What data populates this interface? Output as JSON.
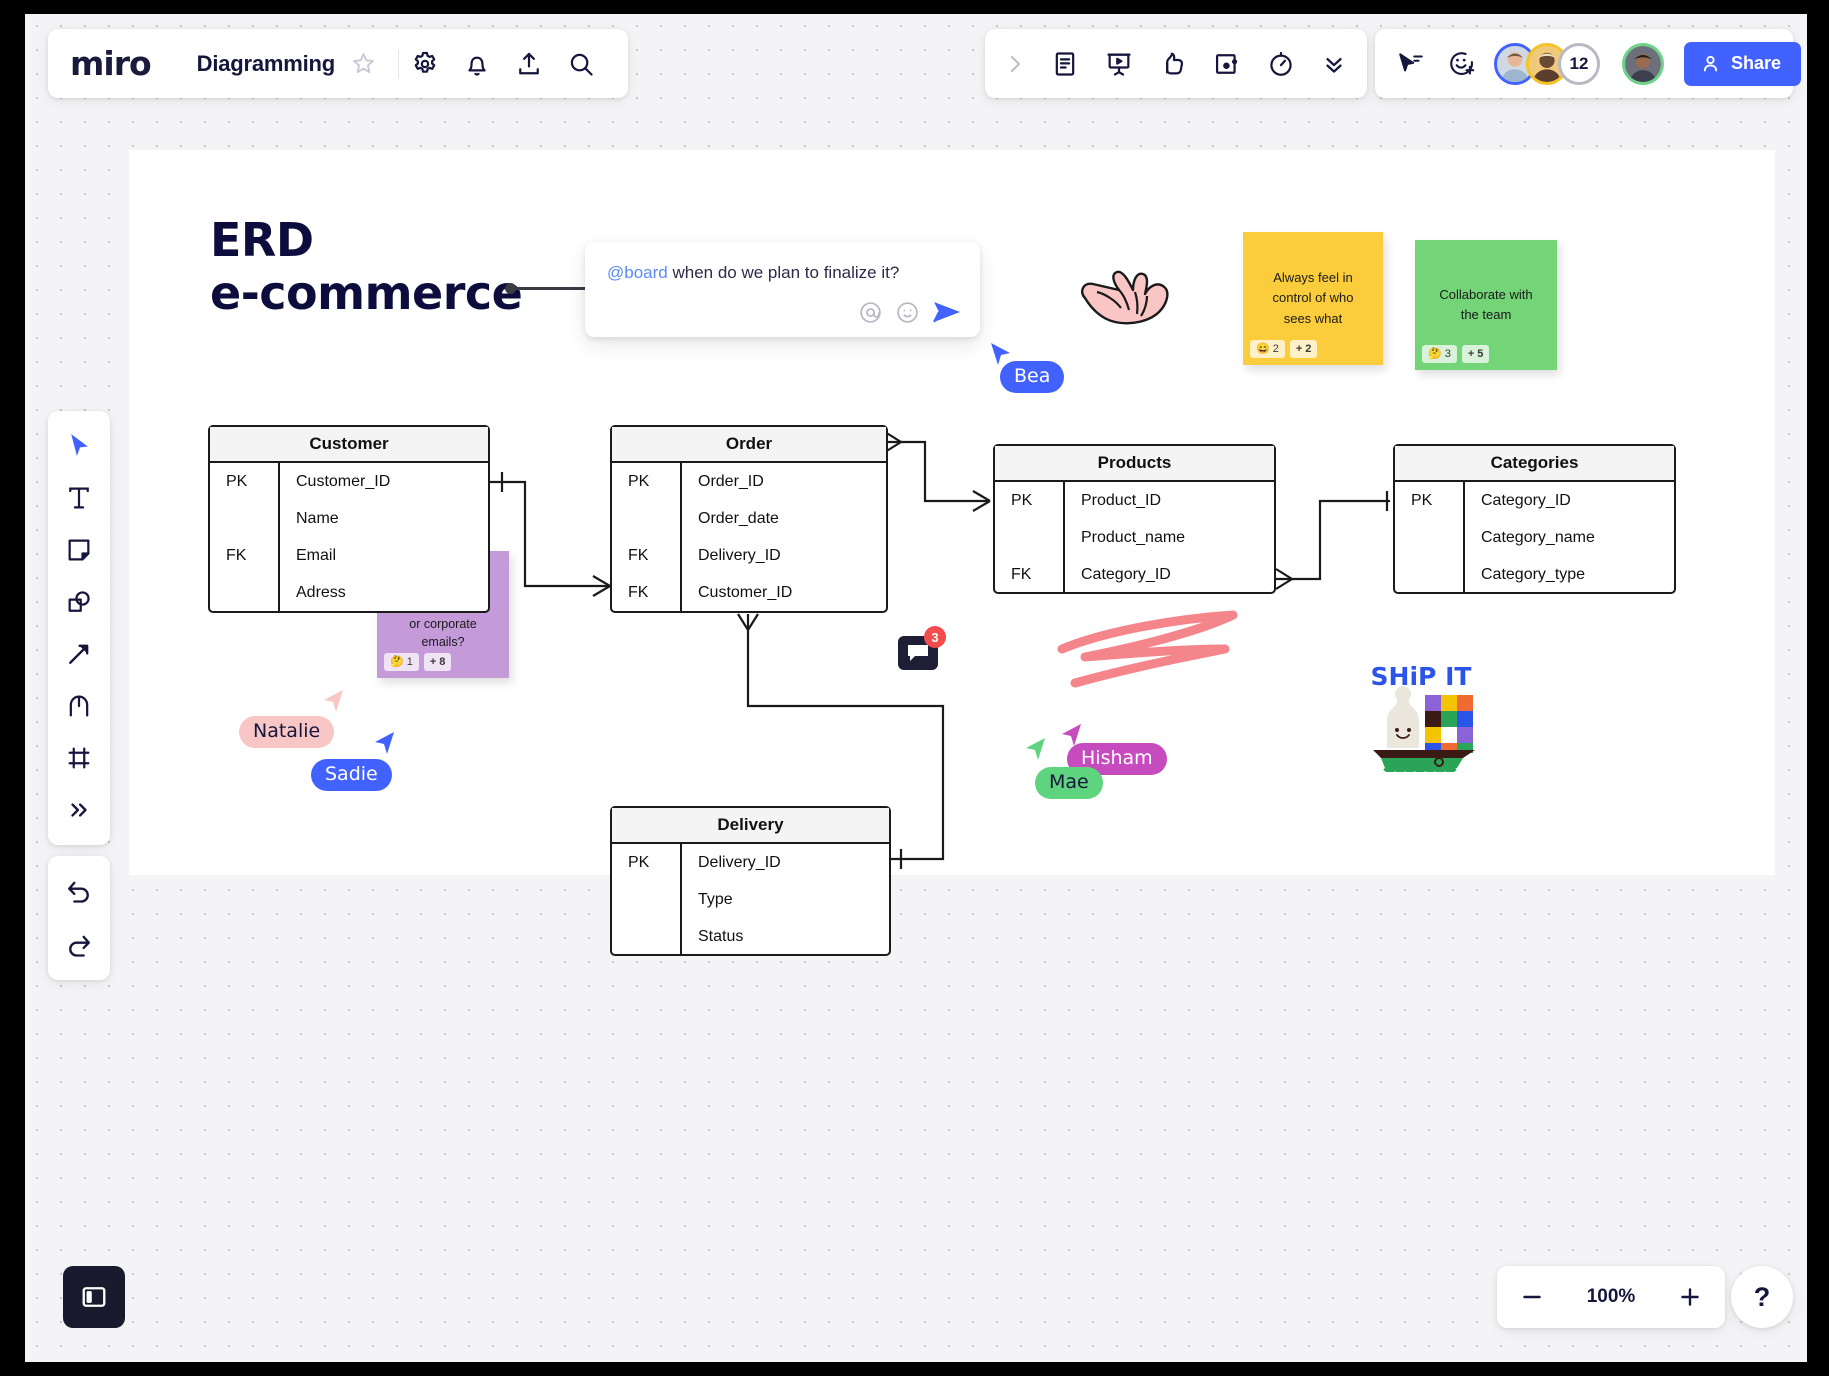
{
  "app": {
    "name": "miro",
    "board_name": "Diagramming"
  },
  "topbar_left": {
    "icons": [
      {
        "name": "star-icon",
        "label": "Favorite"
      },
      {
        "name": "gear-icon",
        "label": "Settings"
      },
      {
        "name": "bell-icon",
        "label": "Notifications"
      },
      {
        "name": "upload-icon",
        "label": "Export"
      },
      {
        "name": "search-icon",
        "label": "Search"
      }
    ]
  },
  "topbar_center": {
    "icons": [
      {
        "name": "chevron-right-icon",
        "label": "Expand"
      },
      {
        "name": "document-icon",
        "label": "Notes"
      },
      {
        "name": "presentation-icon",
        "label": "Presentation mode"
      },
      {
        "name": "thumbs-up-icon",
        "label": "Voting"
      },
      {
        "name": "screen-share-icon",
        "label": "Screen share"
      },
      {
        "name": "timer-icon",
        "label": "Timer"
      },
      {
        "name": "chevrons-down-icon",
        "label": "More tools"
      }
    ]
  },
  "topbar_right": {
    "icons": [
      {
        "name": "cursor-follow-icon",
        "label": "Follow cursor"
      },
      {
        "name": "add-reaction-icon",
        "label": "Add reaction"
      }
    ],
    "avatar_overflow_count": "12",
    "share_label": "Share"
  },
  "left_rail": {
    "tools": [
      {
        "name": "select-tool",
        "label": "Select"
      },
      {
        "name": "text-tool",
        "label": "Text"
      },
      {
        "name": "sticky-note-tool",
        "label": "Sticky note"
      },
      {
        "name": "shapes-tool",
        "label": "Shapes"
      },
      {
        "name": "connector-tool",
        "label": "Connection line"
      },
      {
        "name": "pen-tool",
        "label": "Pen"
      },
      {
        "name": "frame-tool",
        "label": "Frame"
      },
      {
        "name": "more-tools",
        "label": "More apps"
      }
    ],
    "history": [
      {
        "name": "undo-button",
        "label": "Undo"
      },
      {
        "name": "redo-button",
        "label": "Redo"
      }
    ]
  },
  "bottom_bar": {
    "panel_toggle_label": "Toggle panel",
    "zoom_out_label": "−",
    "zoom_level": "100%",
    "zoom_in_label": "+",
    "help_label": "?"
  },
  "canvas": {
    "title_line1": "ERD",
    "title_line2": "e-commerce",
    "comment": {
      "mention": "@board",
      "text": " when do we plan to finalize it?",
      "actions": [
        {
          "name": "mention-icon",
          "label": "@"
        },
        {
          "name": "emoji-icon",
          "label": "Emoji"
        },
        {
          "name": "send-icon",
          "label": "Send"
        }
      ]
    },
    "comment_pin": {
      "count": "3"
    },
    "stickers": {
      "ship_it": "SHiP IT"
    },
    "sticky_notes": [
      {
        "id": "sticky-yellow",
        "text": "Always feel in control of who sees what",
        "color": "#fbcd3c",
        "reactions": [
          {
            "emoji": "😄",
            "count": "2"
          },
          {
            "emoji": "+",
            "count": "2"
          }
        ]
      },
      {
        "id": "sticky-green",
        "text": "Collaborate with the team",
        "color": "#74d478",
        "reactions": [
          {
            "emoji": "🤔",
            "count": "3"
          },
          {
            "emoji": "+",
            "count": "5"
          }
        ]
      },
      {
        "id": "sticky-purple",
        "text": "Do we plan to collect personal or corporate emails?",
        "color": "#c59ad9",
        "reactions": [
          {
            "emoji": "🤔",
            "count": "1"
          },
          {
            "emoji": "+",
            "count": "8"
          }
        ]
      }
    ],
    "collaborators": [
      {
        "name": "Bea",
        "color": "#4262ff",
        "text_color": "#ffffff"
      },
      {
        "name": "Natalie",
        "color": "#f9c6c6",
        "text_color": "#16163c"
      },
      {
        "name": "Sadie",
        "color": "#4262ff",
        "text_color": "#ffffff"
      },
      {
        "name": "Hisham",
        "color": "#c64bbf",
        "text_color": "#ffffff"
      },
      {
        "name": "Mae",
        "color": "#5ed47f",
        "text_color": "#16163c"
      }
    ],
    "erd_tables": [
      {
        "id": "customer",
        "title": "Customer",
        "rows": [
          {
            "key": "PK",
            "field": "Customer_ID"
          },
          {
            "key": "",
            "field": "Name"
          },
          {
            "key": "FK",
            "field": "Email"
          },
          {
            "key": "",
            "field": "Adress"
          }
        ]
      },
      {
        "id": "order",
        "title": "Order",
        "rows": [
          {
            "key": "PK",
            "field": "Order_ID"
          },
          {
            "key": "",
            "field": "Order_date"
          },
          {
            "key": "FK",
            "field": "Delivery_ID"
          },
          {
            "key": "FK",
            "field": "Customer_ID"
          }
        ]
      },
      {
        "id": "products",
        "title": "Products",
        "rows": [
          {
            "key": "PK",
            "field": "Product_ID"
          },
          {
            "key": "",
            "field": "Product_name"
          },
          {
            "key": "FK",
            "field": "Category_ID"
          }
        ]
      },
      {
        "id": "categories",
        "title": "Categories",
        "rows": [
          {
            "key": "PK",
            "field": "Category_ID"
          },
          {
            "key": "",
            "field": "Category_name"
          },
          {
            "key": "",
            "field": "Category_type"
          }
        ]
      },
      {
        "id": "delivery",
        "title": "Delivery",
        "rows": [
          {
            "key": "PK",
            "field": "Delivery_ID"
          },
          {
            "key": "",
            "field": "Type"
          },
          {
            "key": "",
            "field": "Status"
          }
        ]
      }
    ]
  },
  "colors": {
    "brand": "#4262ff",
    "ink": "#16163c",
    "canvas": "#f4f4f6"
  }
}
